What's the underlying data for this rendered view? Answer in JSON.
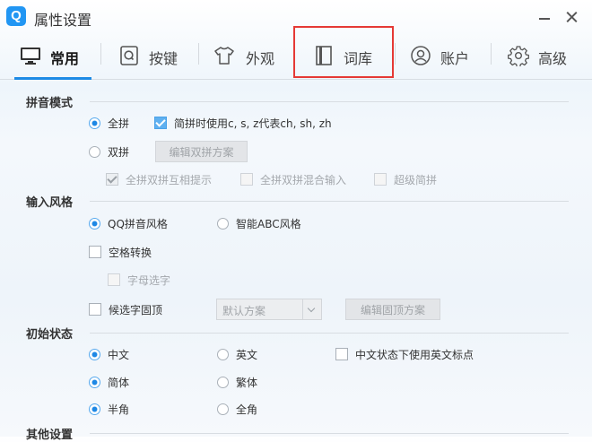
{
  "window": {
    "logo": "Q",
    "title": "属性设置",
    "icons": [
      "app-logo",
      "minimize-icon",
      "close-icon"
    ]
  },
  "tabs": [
    {
      "label": "常用",
      "icon": "monitor-icon",
      "active": true
    },
    {
      "label": "按键",
      "icon": "key-icon"
    },
    {
      "label": "外观",
      "icon": "tshirt-icon"
    },
    {
      "label": "词库",
      "icon": "book-icon"
    },
    {
      "label": "账户",
      "icon": "user-icon"
    },
    {
      "label": "高级",
      "icon": "gear-icon"
    }
  ],
  "colors": {
    "accent": "#1d8ae5",
    "highlight_box": "#e53935",
    "checked_fill": "#5fb0f0"
  },
  "pinyin": {
    "heading": "拼音模式",
    "full_label": "全拼",
    "abbr_label": "简拼时使用c, s, z代表ch, sh, zh",
    "double_label": "双拼",
    "edit_double_button": "编辑双拼方案",
    "hint_label": "全拼双拼互相提示",
    "mixed_label": "全拼双拼混合输入",
    "super_label": "超级简拼"
  },
  "style": {
    "heading": "输入风格",
    "qq_label": "QQ拼音风格",
    "abc_label": "智能ABC风格",
    "space_label": "空格转换",
    "letter_label": "字母选字",
    "pin_label": "候选字固顶",
    "scheme_value": "默认方案",
    "edit_pin_button": "编辑固顶方案"
  },
  "initial": {
    "heading": "初始状态",
    "chinese_label": "中文",
    "english_label": "英文",
    "punct_label": "中文状态下使用英文标点",
    "simplified_label": "简体",
    "traditional_label": "繁体",
    "half_label": "半角",
    "full_width_label": "全角"
  },
  "other": {
    "heading": "其他设置"
  }
}
